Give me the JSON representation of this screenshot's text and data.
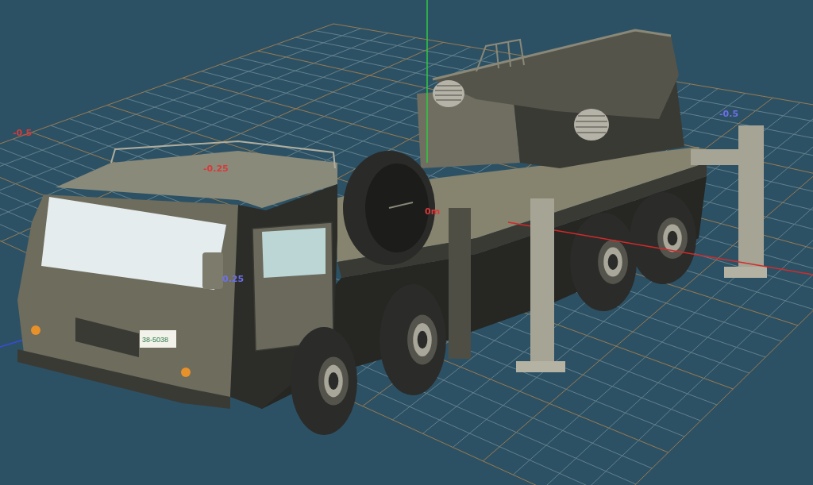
{
  "viewport": {
    "axis_labels": [
      {
        "text": "-0.5",
        "color": "#d83a3a"
      },
      {
        "text": "-0.25",
        "color": "#d83a3a"
      },
      {
        "text": "0m",
        "color": "#d83a3a"
      },
      {
        "text": "0.25",
        "color": "#6c70e8"
      },
      {
        "text": "-0.5",
        "color": "#6c70e8"
      }
    ]
  },
  "truck": {
    "license_plate": "38-5038"
  }
}
